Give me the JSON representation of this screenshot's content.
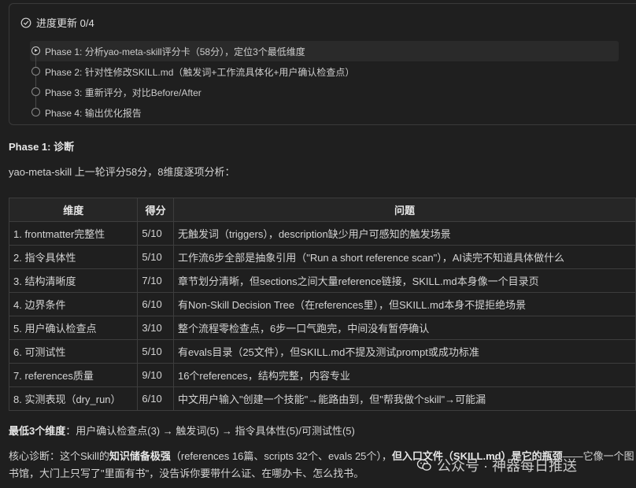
{
  "progress": {
    "title": "进度更新 0/4",
    "phases": [
      {
        "label": "Phase 1: 分析yao-meta-skill评分卡（58分），定位3个最低维度",
        "state": "current"
      },
      {
        "label": "Phase 2: 针对性修改SKILL.md（触发词+工作流具体化+用户确认检查点）",
        "state": "pending"
      },
      {
        "label": "Phase 3: 重新评分，对比Before/After",
        "state": "pending"
      },
      {
        "label": "Phase 4: 输出优化报告",
        "state": "pending"
      }
    ]
  },
  "section_title": "Phase 1: 诊断",
  "intro": "yao-meta-skill 上一轮评分58分，8维度逐项分析：",
  "table": {
    "headers": [
      "维度",
      "得分",
      "问题"
    ],
    "rows": [
      [
        "1. frontmatter完整性",
        "5/10",
        "无触发词（triggers），description缺少用户可感知的触发场景"
      ],
      [
        "2. 指令具体性",
        "5/10",
        "工作流6步全部是抽象引用（\"Run a short reference scan\"），AI读完不知道具体做什么"
      ],
      [
        "3. 结构清晰度",
        "7/10",
        "章节划分清晰，但sections之间大量reference链接，SKILL.md本身像一个目录页"
      ],
      [
        "4. 边界条件",
        "6/10",
        "有Non-Skill Decision Tree（在references里），但SKILL.md本身不提拒绝场景"
      ],
      [
        "5. 用户确认检查点",
        "3/10",
        "整个流程零检查点，6步一口气跑完，中间没有暂停确认"
      ],
      [
        "6. 可测试性",
        "5/10",
        "有evals目录（25文件），但SKILL.md不提及测试prompt或成功标准"
      ],
      [
        "7. references质量",
        "9/10",
        "16个references，结构完整，内容专业"
      ],
      [
        "8. 实测表现（dry_run）",
        "6/10",
        "中文用户输入\"创建一个技能\"→能路由到，但\"帮我做个skill\"→可能漏"
      ]
    ]
  },
  "summary": {
    "label": "最低3个维度",
    "text": "：用户确认检查点(3) → 触发词(5) → 指令具体性(5)/可测试性(5)"
  },
  "core": {
    "part1": "核心诊断：这个Skill的",
    "bold1": "知识储备极强",
    "part2": "（references 16篇、scripts 32个、evals 25个），",
    "bold2": "但入口文件（SKILL.md）是它的瓶颈",
    "part3": "——它像一个图",
    "line2": "书馆，大门上只写了\"里面有书\"，没告诉你要带什么证、在哪办卡、怎么找书。"
  },
  "watermark": {
    "text": "公众号 · 神器每日推送",
    "icon": "wechat-icon"
  }
}
